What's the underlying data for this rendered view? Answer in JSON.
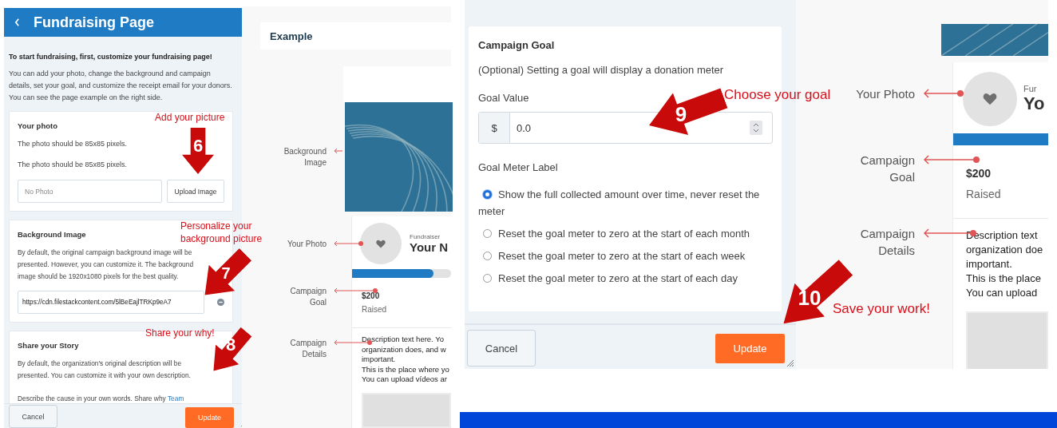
{
  "left_screen": {
    "header": {
      "title": "Fundraising Page"
    },
    "intro": {
      "heading": "To start fundraising, first, customize your fundraising page!",
      "text": "You can add your photo, change the background and campaign details, set your goal, and customize the receipt email for your donors. You can see the page example on the right side."
    },
    "photo_card": {
      "title": "Your photo",
      "notes": [
        "The photo should be 85x85 pixels.",
        "The photo should be 85x85 pixels."
      ],
      "field": {
        "placeholder": "No Photo"
      },
      "button": "Upload Image"
    },
    "background_card": {
      "title": "Background Image",
      "text": "By default, the original campaign background image will be presented. However, you can customize it. The background image should be 1920x1080 pixels for the best quality.",
      "field": {
        "value": "https://cdn.filestackcontent.com/5lBeEajlTRKp9eA7"
      }
    },
    "story_card": {
      "title": "Share your Story",
      "text": "By default, the organization's original description will be presented. You can customize it with your own description.",
      "cause_text": "Describe the cause in your own words. Share why",
      "link": "Team"
    },
    "footer": {
      "cancel": "Cancel",
      "update": "Update"
    },
    "example": {
      "title": "Example",
      "callouts": [
        "Background Image",
        "Your Photo",
        "Campaign Goal",
        "Campaign Details"
      ],
      "preview": {
        "role": "Fundraiser",
        "name": "Your N",
        "level": 0.82,
        "amount": "$200",
        "amount_label": "Raised",
        "description": [
          "Description text here. Yo",
          "organization does, and w",
          "important.",
          "This is the place where yo",
          "You can upload vídeos ar"
        ]
      }
    }
  },
  "right_screen": {
    "goal_card": {
      "title": "Campaign Goal",
      "note": "(Optional) Setting a goal will display a donation meter",
      "goal_label": "Goal Value",
      "currency": "$",
      "goal_value": "0.0",
      "meter_label": "Goal Meter Label",
      "options": [
        {
          "label": "Show the full collected amount over time, never reset the meter",
          "selected": true
        },
        {
          "label": "Reset the goal meter to zero at the start of each month",
          "selected": false
        },
        {
          "label": "Reset the goal meter to zero at the start of each week",
          "selected": false
        },
        {
          "label": "Reset the goal meter to zero at the start of each day",
          "selected": false
        }
      ]
    },
    "footer": {
      "cancel": "Cancel",
      "update": "Update"
    },
    "example": {
      "callouts": [
        "Your Photo",
        "Campaign Goal",
        "Campaign Details"
      ],
      "preview": {
        "role": "Fur",
        "name": "Yo",
        "level": 1,
        "amount": "$200",
        "amount_label": "Raised",
        "description": [
          "Description text",
          "organization doe",
          "important.",
          "This is the place",
          "You can upload"
        ]
      }
    }
  },
  "annotations": [
    {
      "step": "6",
      "text": "Add your picture"
    },
    {
      "step": "7",
      "text": "Personalize your background picture"
    },
    {
      "step": "8",
      "text": "Share your why!"
    },
    {
      "step": "9",
      "text": "Choose your goal"
    },
    {
      "step": "10",
      "text": "Save your work!"
    }
  ]
}
